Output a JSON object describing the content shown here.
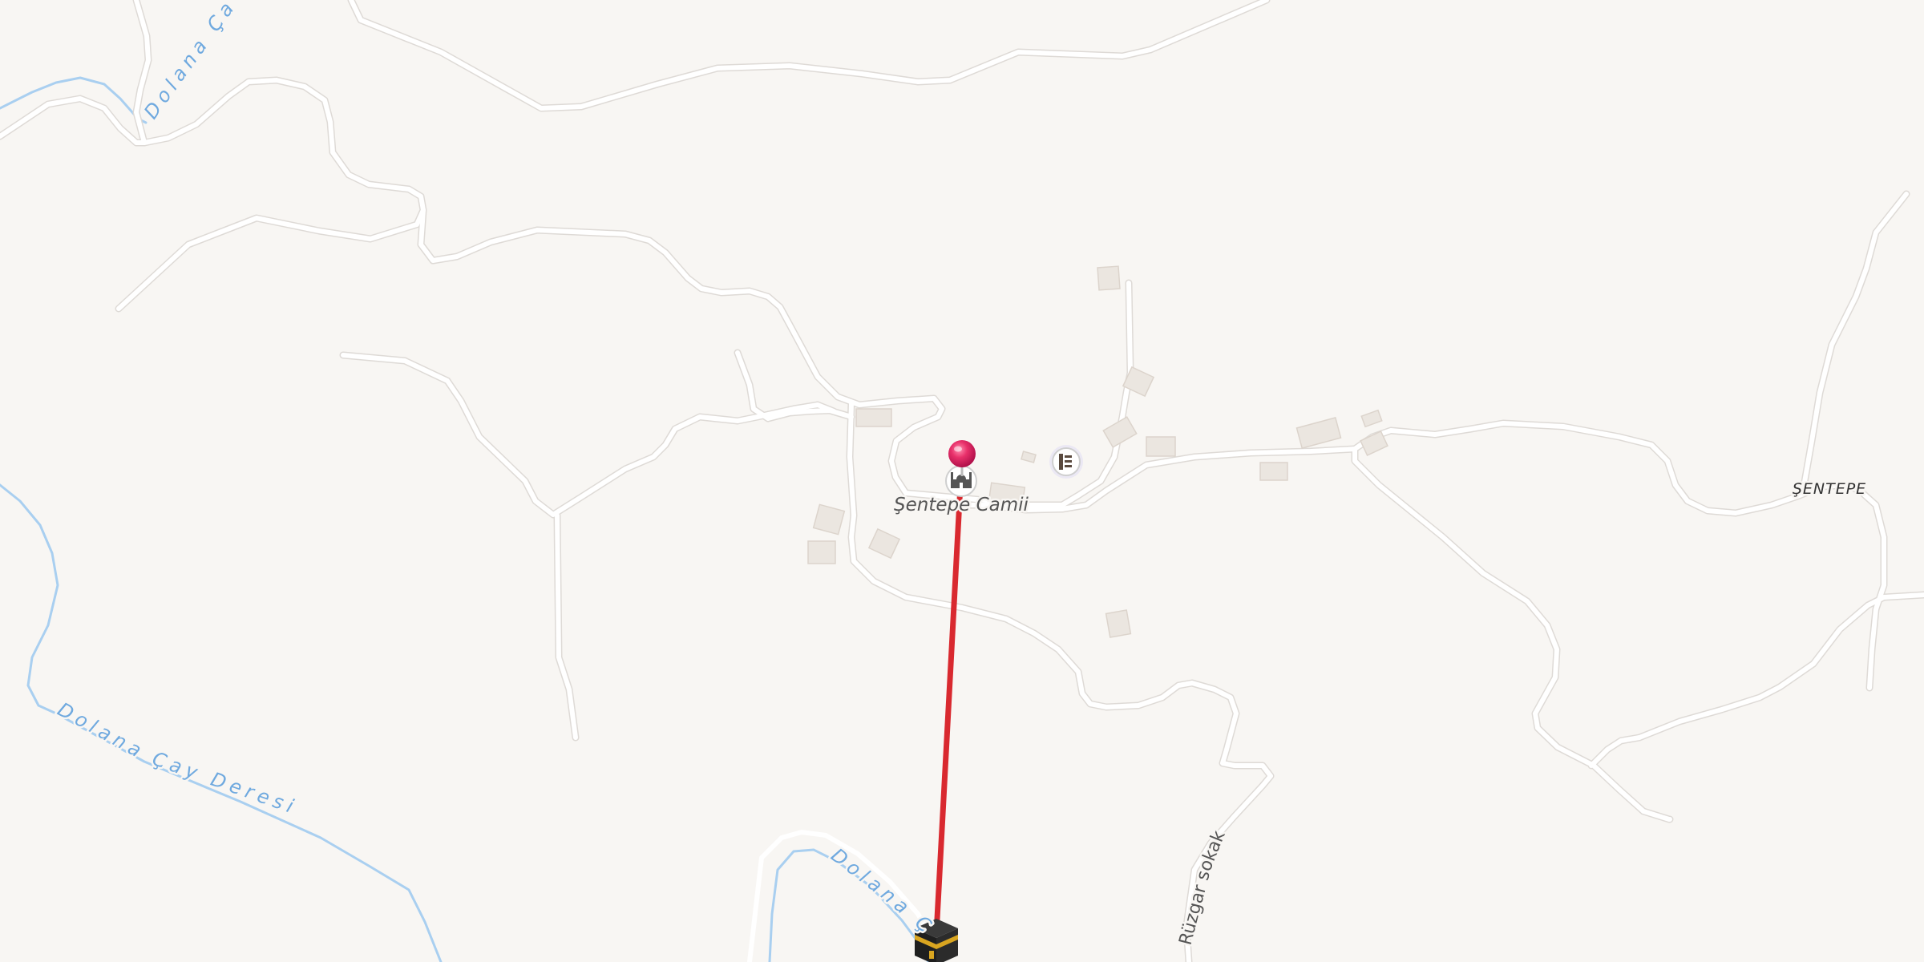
{
  "map": {
    "labels": {
      "river_top": "Dolana Çay",
      "river_main": "Dolana Çay Deresi",
      "river_bottom": "Dolana Ç",
      "road_ruzgar": "Rüzgar sokak",
      "poi_mosque": "Şentepe Camii",
      "place_sentepe": "ŞENTEPE"
    },
    "icons": {
      "location_pin": "location-pin-icon",
      "mosque": "mosque-icon",
      "library": "library-icon",
      "kaaba": "kaaba-icon"
    },
    "colors": {
      "background": "#f8f6f3",
      "road": "#ffffff",
      "river": "#a9cff0",
      "qibla_line": "#d9292f",
      "pin": "#e8306a"
    }
  }
}
